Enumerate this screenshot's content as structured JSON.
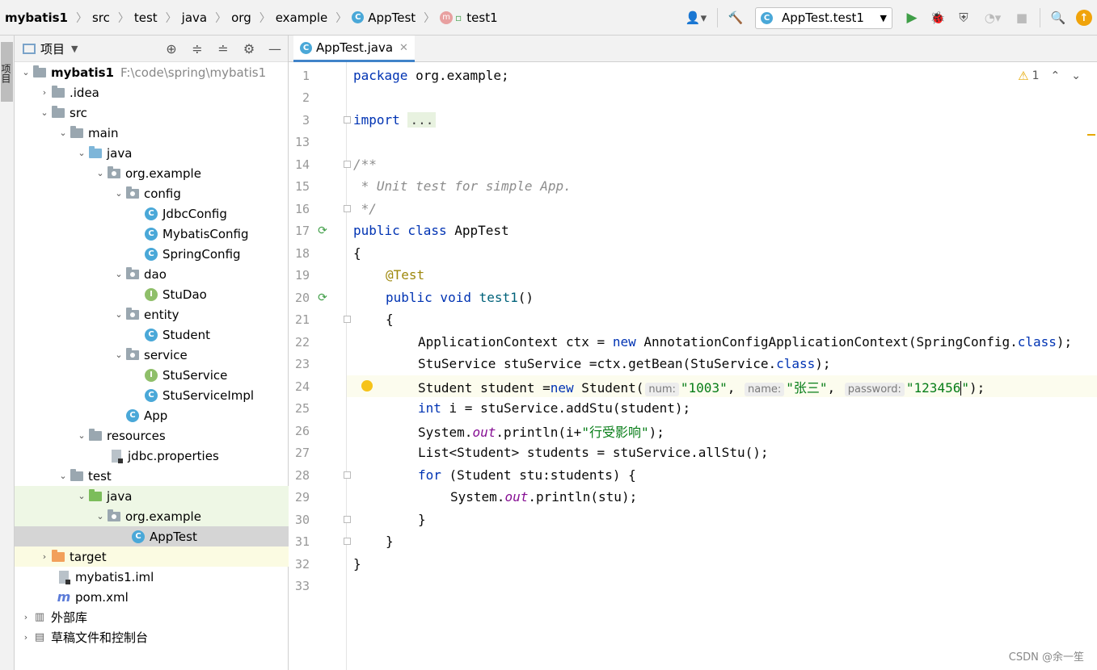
{
  "breadcrumbs": [
    "mybatis1",
    "src",
    "test",
    "java",
    "org",
    "example",
    "AppTest",
    "test1"
  ],
  "toolbar": {
    "run_config": "AppTest.test1",
    "colors": {
      "run": "#3f9e47",
      "update": "#f0a30a"
    }
  },
  "left_strip": {
    "label": "项目"
  },
  "project_panel": {
    "title": "项目",
    "tree": [
      {
        "label": "mybatis1",
        "extra": "F:\\code\\spring\\mybatis1"
      },
      {
        "label": ".idea"
      },
      {
        "label": "src"
      },
      {
        "label": "main"
      },
      {
        "label": "java"
      },
      {
        "label": "org.example"
      },
      {
        "label": "config"
      },
      {
        "label": "JdbcConfig"
      },
      {
        "label": "MybatisConfig"
      },
      {
        "label": "SpringConfig"
      },
      {
        "label": "dao"
      },
      {
        "label": "StuDao"
      },
      {
        "label": "entity"
      },
      {
        "label": "Student"
      },
      {
        "label": "service"
      },
      {
        "label": "StuService"
      },
      {
        "label": "StuServiceImpl"
      },
      {
        "label": "App"
      },
      {
        "label": "resources"
      },
      {
        "label": "jdbc.properties"
      },
      {
        "label": "test"
      },
      {
        "label": "java"
      },
      {
        "label": "org.example"
      },
      {
        "label": "AppTest"
      },
      {
        "label": "target"
      },
      {
        "label": "mybatis1.iml"
      },
      {
        "label": "pom.xml"
      },
      {
        "label": "外部库"
      },
      {
        "label": "草稿文件和控制台"
      }
    ]
  },
  "editor": {
    "tab_label": "AppTest.java",
    "warning_count": "1",
    "line_numbers": [
      "1",
      "2",
      "3",
      "13",
      "14",
      "15",
      "16",
      "17",
      "18",
      "19",
      "20",
      "21",
      "22",
      "23",
      "24",
      "25",
      "26",
      "27",
      "28",
      "29",
      "30",
      "31",
      "32",
      "33"
    ],
    "code": {
      "pkg_kw": "package",
      "pkg_name": " org.example;",
      "import_kw": "import",
      "import_fold": "...",
      "doc_open": "/**",
      "doc_text": " * Unit test for simple App.",
      "doc_close": " */",
      "l17_kw": "public class",
      "l17_name": " AppTest",
      "brace_open": "{",
      "annotation": "@Test",
      "l20_kw": "public void",
      "l20_fn": "test1",
      "l20_rest": "()",
      "l21": "{",
      "l22_a": "ApplicationContext ctx = ",
      "l22_new": "new",
      "l22_b": " AnnotationConfigApplicationContext(SpringConfig.",
      "l22_class": "class",
      "l22_c": ");",
      "l23_a": "StuService stuService =ctx.getBean(StuService.",
      "l23_class": "class",
      "l23_c": ");",
      "l24_a": "Student student =",
      "l24_new": "new",
      "l24_b": " Student(",
      "hint_num": "num:",
      "val_num": "\"1003\"",
      "comma1": ",",
      "hint_name": "name:",
      "val_name": "\"张三\"",
      "comma2": ",",
      "hint_password": "password:",
      "val_password_a": "\"123456",
      "val_password_b": "\"",
      "l24_end": ");",
      "l25_kw": "int",
      "l25_rest": " i = stuService.addStu(student);",
      "l26_a": "System.",
      "l26_out": "out",
      "l26_b": ".println(i+",
      "l26_str": "\"行受影响\"",
      "l26_c": ");",
      "l27": "List<Student> students = stuService.allStu();",
      "l28_kw": "for",
      "l28_rest": " (Student stu:students) {",
      "l29_a": "System.",
      "l29_out": "out",
      "l29_b": ".println(stu);",
      "l30": "}",
      "l31": "}",
      "l32": "}"
    }
  },
  "watermark": "CSDN @余一笙"
}
